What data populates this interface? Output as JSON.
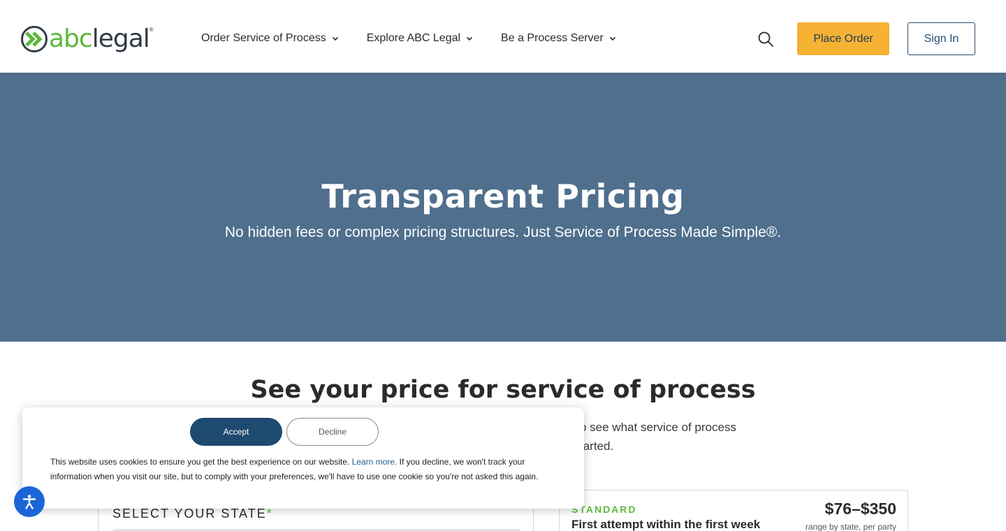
{
  "header": {
    "logo": {
      "abc": "abc",
      "legal": "legal",
      "reg": "®"
    },
    "nav": [
      {
        "label": "Order Service of Process"
      },
      {
        "label": "Explore ABC Legal"
      },
      {
        "label": "Be a Process Server"
      }
    ],
    "icons": {
      "search": "search-icon",
      "chevron": "chevron-down-icon"
    },
    "place_order_label": "Place Order",
    "sign_in_label": "Sign In"
  },
  "hero": {
    "title": "Transparent Pricing",
    "subtitle": "No hidden fees or complex pricing structures. Just Service of Process Made Simple®."
  },
  "pricing": {
    "title": "See your price for service of process",
    "desc_line1": "o see what service of process",
    "desc_line2": "tarted.",
    "state_label": "SELECT YOUR STATE",
    "required_mark": "*",
    "tier": "STANDARD",
    "tier_desc": "First attempt within the first week",
    "price": "$76–$350",
    "price_note": "range by state, per party"
  },
  "cookie": {
    "accept_label": "Accept",
    "decline_label": "Decline",
    "text_before": "This website uses cookies to ensure you get the best experience on our website. ",
    "learn_more": "Learn more.",
    "text_after": " If you decline, we won't track your information when you visit our site, but to comply with your preferences, we'll have to use one cookie so you're not asked this again."
  },
  "colors": {
    "brand_green": "#5cb83c",
    "hero_bg": "#4f6f8d",
    "place_order_bg": "#f6b233",
    "accept_bg": "#1f4a70",
    "a11y_bg": "#1a66d6"
  },
  "accessibility_widget": {
    "icon": "accessibility-icon"
  }
}
